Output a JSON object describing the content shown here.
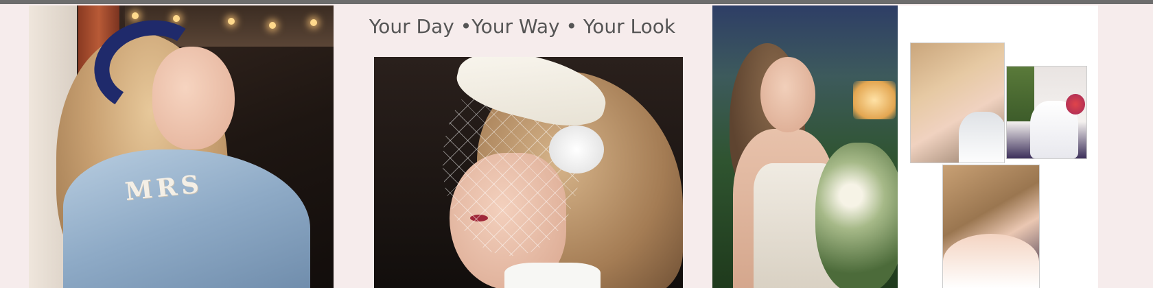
{
  "header": {
    "tagline": "Your Day •Your Way • Your Look"
  },
  "photos": {
    "denim_bride": {
      "jacket_text": "MRS"
    }
  },
  "colors": {
    "page_background": "#f6ecec",
    "tagline_text": "#555555",
    "headband_navy": "#1f2a6b"
  }
}
